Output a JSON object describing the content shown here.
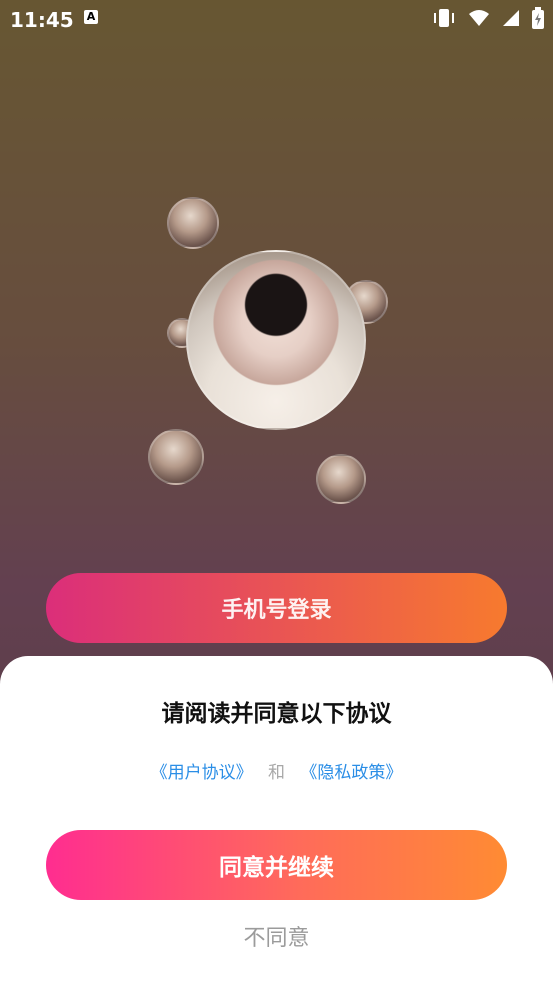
{
  "status_bar": {
    "time": "11:45",
    "notification_icon": "a-icon",
    "icons": [
      "vibrate-icon",
      "wifi-icon",
      "signal-icon",
      "battery-icon"
    ]
  },
  "background": {
    "phone_login_button": "手机号登录"
  },
  "dialog": {
    "title": "请阅读并同意以下协议",
    "user_agreement": "《用户协议》",
    "and": "和",
    "privacy_policy": "《隐私政策》",
    "agree_button": "同意并继续",
    "disagree_button": "不同意"
  },
  "colors": {
    "link": "#2b8ee6",
    "agree_gradient_start": "#ff2d90",
    "agree_gradient_end": "#ff8b33"
  }
}
